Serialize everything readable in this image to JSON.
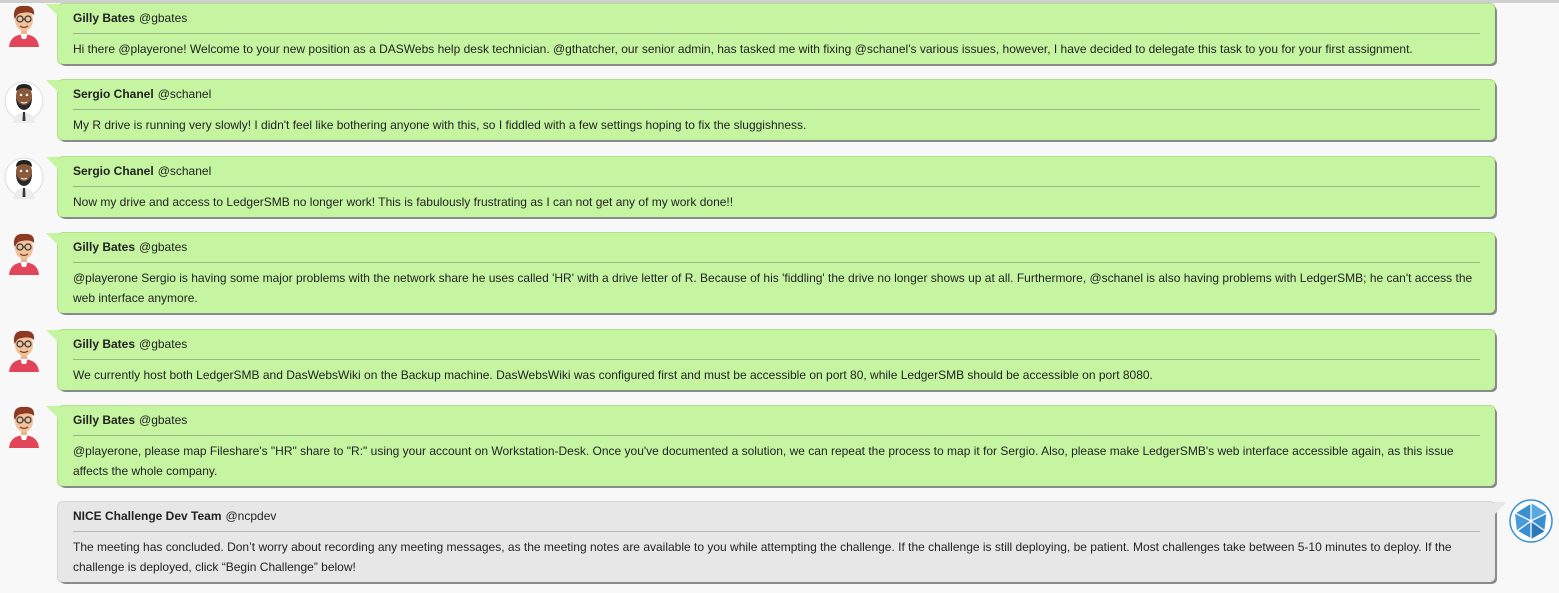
{
  "messages": [
    {
      "name": "Gilly Bates",
      "handle": "@gbates",
      "text": "Hi there @playerone! Welcome to your new position as a DASWebs help desk technician. @gthatcher, our senior admin, has tasked me with fixing @schanel's various issues, however, I have decided to delegate this task to you for your first assignment.",
      "avatar": "gilly-bates-avatar"
    },
    {
      "name": "Sergio Chanel",
      "handle": "@schanel",
      "text": "My R drive is running very slowly! I didn't feel like bothering anyone with this, so I fiddled with a few settings hoping to fix the sluggishness.",
      "avatar": "sergio-chanel-avatar"
    },
    {
      "name": "Sergio Chanel",
      "handle": "@schanel",
      "text": "Now my drive and access to LedgerSMB no longer work! This is fabulously frustrating as I can not get any of my work done!!",
      "avatar": "sergio-chanel-avatar"
    },
    {
      "name": "Gilly Bates",
      "handle": "@gbates",
      "text": "@playerone Sergio is having some major problems with the network share he uses called 'HR' with a drive letter of R. Because of his 'fiddling' the drive no longer shows up at all. Furthermore, @schanel is also having problems with LedgerSMB; he can't access the web interface anymore.",
      "avatar": "gilly-bates-avatar"
    },
    {
      "name": "Gilly Bates",
      "handle": "@gbates",
      "text": "We currently host both LedgerSMB and DasWebsWiki on the Backup machine. DasWebsWiki was configured first and must be accessible on port 80, while LedgerSMB should be accessible on port 8080.",
      "avatar": "gilly-bates-avatar"
    },
    {
      "name": "Gilly Bates",
      "handle": "@gbates",
      "text": "@playerone, please map Fileshare's \"HR\" share to \"R:\" using your account on Workstation-Desk. Once you've documented a solution, we can repeat the process to map it for Sergio. Also, please make LedgerSMB's web interface accessible again, as this issue affects the whole company.",
      "avatar": "gilly-bates-avatar"
    },
    {
      "name": "NICE Challenge Dev Team",
      "handle": "@ncpdev",
      "text": "The meeting has concluded. Don’t worry about recording any meeting messages, as the meeting notes are available to you while attempting the challenge. If the challenge is still deploying, be patient. Most challenges take between 5-10 minutes to deploy. If the challenge is deployed, click “Begin Challenge” below!",
      "avatar": "nice-challenge-logo"
    }
  ],
  "colors": {
    "user_bubble": "#c6f5a2",
    "dev_bubble": "#e7e7e7",
    "background": "#f8f8f8"
  }
}
